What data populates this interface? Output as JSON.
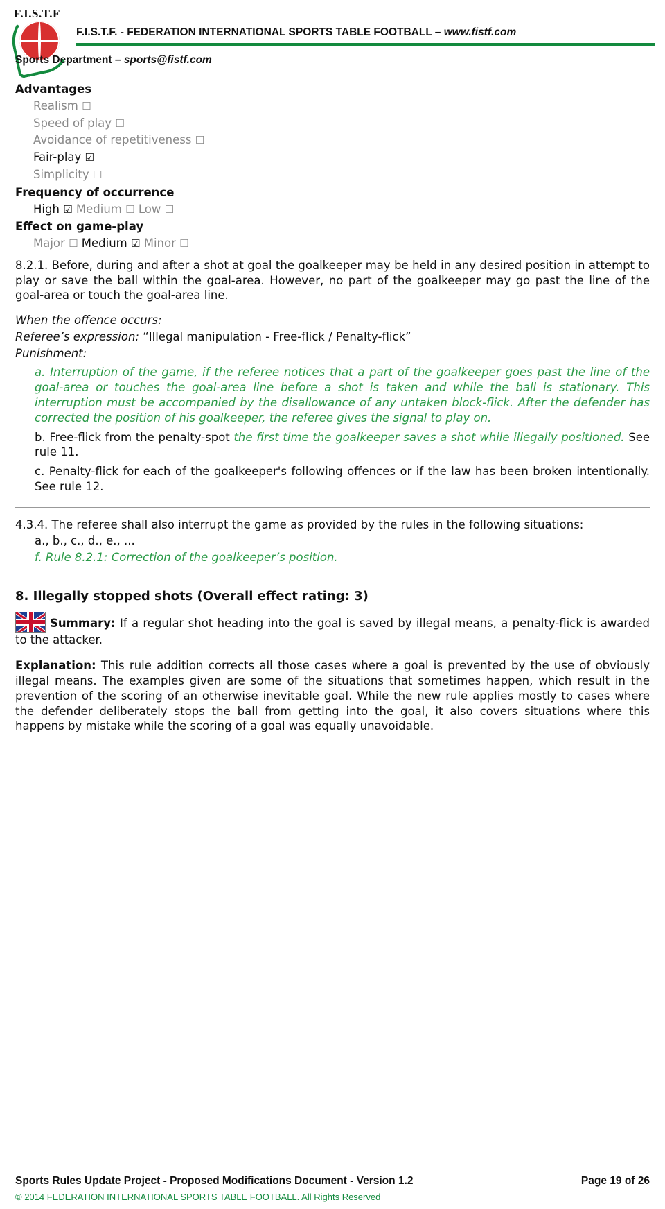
{
  "header": {
    "org_line": "F.I.S.T.F. - FEDERATION INTERNATIONAL SPORTS TABLE FOOTBALL – ",
    "org_url": "www.fistf.com",
    "dept_label": "Sports Department – ",
    "dept_email": "sports@fistf.com",
    "logo_text": "F.I.S.T.F",
    "accent_color": "#138a3e"
  },
  "ratings": {
    "advantages_title": "Advantages",
    "items": [
      {
        "label": "Realism",
        "checked": false
      },
      {
        "label": "Speed of play",
        "checked": false
      },
      {
        "label": "Avoidance of repetitiveness",
        "checked": false
      },
      {
        "label": "Fair-play",
        "checked": true
      },
      {
        "label": "Simplicity",
        "checked": false
      }
    ],
    "frequency_title": "Frequency of occurrence",
    "frequency_options": [
      {
        "label": "High",
        "checked": true
      },
      {
        "label": "Medium",
        "checked": false
      },
      {
        "label": "Low",
        "checked": false
      }
    ],
    "effect_title": "Effect on game-play",
    "effect_options": [
      {
        "label": "Major",
        "checked": false
      },
      {
        "label": "Medium",
        "checked": true
      },
      {
        "label": "Minor",
        "checked": false
      }
    ],
    "checked_glyph": "☑",
    "unchecked_glyph": "☐"
  },
  "rule": {
    "number": "8.2.1.",
    "body": "Before, during and after a shot at goal the goalkeeper may be held in any desired position in attempt to play or save the ball within the goal-area. However, no part of the goalkeeper may go past the line of the goal-area or touch the goal-area line.",
    "when_label": "When the offence occurs:",
    "referee_label": "Referee’s expression:",
    "referee_text": " “Illegal manipulation - Free-flick / Penalty-flick”",
    "punishment_label": "Punishment:",
    "punishment_a": "a. Interruption of the game, if the referee notices that a part of the goalkeeper goes past the line of the goal-area or touches the goal-area line before a shot is taken and while the ball is stationary. This interruption must be accompanied by the disallowance of any untaken block-flick. After the defender has corrected the position of his goalkeeper, the referee gives the signal to play on.",
    "punishment_b_plain1": "b. Free-flick from the penalty-spot ",
    "punishment_b_green": "the first time the goalkeeper saves a shot while illegally positioned.",
    "punishment_b_plain2": " See rule 11.",
    "punishment_c": "c. Penalty-flick for each of the goalkeeper's following offences or if the law has been broken intentionally. See rule 12."
  },
  "rule434": {
    "intro": "4.3.4. The referee shall also interrupt the game as provided by the rules in the following situations:",
    "list": "a., b., c., d., e., ...",
    "item_f": "f. Rule 8.2.1: Correction of the goalkeeper’s position."
  },
  "section8": {
    "title": "8. Illegally stopped shots (Overall effect rating: 3)",
    "summary_label": "Summary:",
    "summary_text": " If a regular shot heading into the goal is saved by illegal means, a penalty-flick is awarded to the attacker.",
    "explanation_label": "Explanation:",
    "explanation_text": " This rule addition corrects all those cases where a goal is prevented by the use of obviously illegal means. The examples given are some of the situations that sometimes happen, which result in the prevention of the scoring of an otherwise inevitable goal. While the new rule applies mostly to cases where the defender deliberately stops the ball from getting into the goal, it also covers situations where this happens by mistake while the scoring of a goal was equally unavoidable.",
    "flag_name": "uk-flag-icon"
  },
  "footer": {
    "left": "Sports Rules Update Project - Proposed Modifications Document - Version 1.2",
    "right": "Page 19 of 26",
    "copyright": "© 2014 FEDERATION INTERNATIONAL SPORTS TABLE FOOTBALL. All Rights Reserved"
  }
}
